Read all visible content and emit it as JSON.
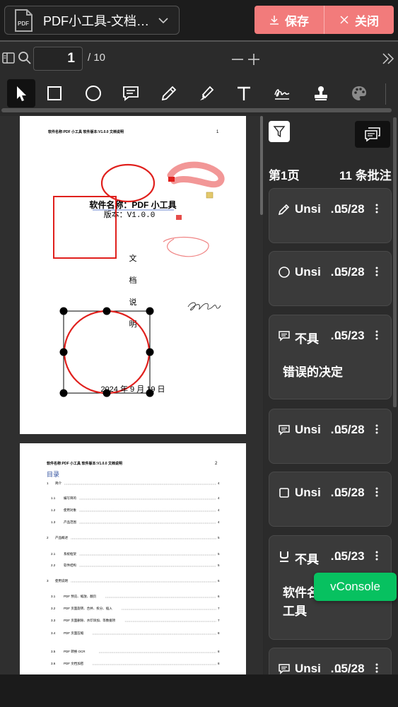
{
  "header": {
    "doc_title": "PDF小工具-文档…",
    "save_label": "保存",
    "close_label": "关闭",
    "pdf_icon_text": "PDF"
  },
  "nav": {
    "current_page": "1",
    "total_pages": "/ 10"
  },
  "tools": [
    {
      "name": "select-tool",
      "icon": "cursor-icon"
    },
    {
      "name": "rectangle-tool",
      "icon": "square-icon"
    },
    {
      "name": "ellipse-tool",
      "icon": "circle-icon"
    },
    {
      "name": "comment-tool",
      "icon": "comment-icon"
    },
    {
      "name": "pen-tool",
      "icon": "pencil-icon"
    },
    {
      "name": "highlighter-tool",
      "icon": "highlighter-icon"
    },
    {
      "name": "text-tool",
      "icon": "text-icon"
    },
    {
      "name": "signature-tool",
      "icon": "signature-icon"
    },
    {
      "name": "stamp-tool",
      "icon": "stamp-icon"
    },
    {
      "name": "color-tool",
      "icon": "palette-icon"
    }
  ],
  "page1": {
    "header_left": "软件名称:PDF 小工具 软件版本:V1.0.0   文档说明",
    "header_right": "1",
    "title": "软件名称：PDF 小工具",
    "version": "版本：V1.0.0",
    "doc_chars": [
      "文",
      "档",
      "说",
      "明"
    ],
    "date": "2024 年 9 月 19 日"
  },
  "page2": {
    "header_left": "软件名称:PDF 小工具 软件版本:V1.0.0   文档说明",
    "header_right": "2",
    "toc_title": "目录",
    "toc": [
      {
        "num": "1",
        "text": "简介",
        "page": "4"
      },
      {
        "num": "1.1",
        "text": "编写目的",
        "page": "4"
      },
      {
        "num": "1.2",
        "text": "使用对象",
        "page": "4"
      },
      {
        "num": "1.3",
        "text": "产品范围",
        "page": "4"
      },
      {
        "num": "2",
        "text": "产品概述",
        "page": "5"
      },
      {
        "num": "2.1",
        "text": "系统框架",
        "page": "5"
      },
      {
        "num": "2.2",
        "text": "软件结构",
        "page": "5"
      },
      {
        "num": "3",
        "text": "使用说明",
        "page": "6"
      },
      {
        "num": "3.1",
        "text": "PDF 预览、缩放、翻页",
        "page": "6"
      },
      {
        "num": "3.2",
        "text": "PDF 页面旋转、合并、拆分、插入",
        "page": "7"
      },
      {
        "num": "3.3",
        "text": "PDF 页面删除、水印添加、等数据项",
        "page": "7"
      },
      {
        "num": "3.4",
        "text": "PDF 页面压缩",
        "page": "8"
      },
      {
        "num": "3.5",
        "text": "PDF 转换 OCR",
        "page": "8"
      },
      {
        "num": "3.6",
        "text": "PDF 文档加密",
        "page": "8"
      }
    ]
  },
  "panel": {
    "page_label": "第1页",
    "count_label": "11 条批注",
    "cards": [
      {
        "icon": "pencil-icon",
        "author": "Unsi",
        "ellipsis": "…",
        "date": "05/28",
        "body": ""
      },
      {
        "icon": "circle-icon",
        "author": "Unsi",
        "ellipsis": "…",
        "date": "05/28",
        "body": ""
      },
      {
        "icon": "comment-icon",
        "author": "不具",
        "ellipsis": "…",
        "date": "05/23",
        "body": "错误的决定"
      },
      {
        "icon": "comment-icon",
        "author": "Unsi",
        "ellipsis": "…",
        "date": "05/28",
        "body": ""
      },
      {
        "icon": "square-icon",
        "author": "Unsi",
        "ellipsis": "…",
        "date": "05/28",
        "body": ""
      },
      {
        "icon": "underline-icon",
        "author": "不具",
        "ellipsis": "…",
        "date": "05/23",
        "body": "软件名称：PDF小工具"
      },
      {
        "icon": "comment-icon",
        "author": "Unsi",
        "ellipsis": "…",
        "date": "05/28",
        "body": ""
      }
    ]
  },
  "vconsole_label": "vConsole",
  "colors": {
    "accent": "#f27b7b",
    "annotation_red": "#e0201d",
    "vconsole_green": "#07c160"
  }
}
